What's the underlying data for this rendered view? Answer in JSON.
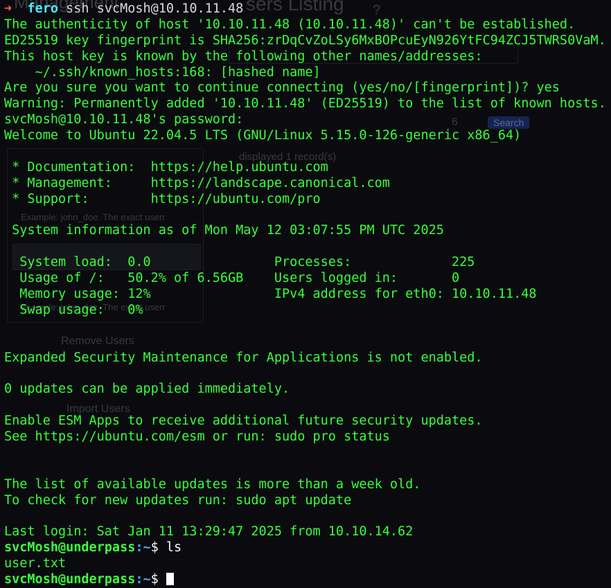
{
  "background": {
    "title_fragment": "sers Listing",
    "partial_texts": [
      "Management",
      "displayed 1 record(s)",
      "Example: john_doe. The exact userr",
      "Example: john_doe. The exact userr",
      "Remove Users",
      "Import Users",
      "6"
    ],
    "badge": "Search"
  },
  "terminal": {
    "prompt_marker": "➜",
    "local_user": "fero",
    "ssh_cmd": "ssh",
    "ssh_target": "svcMosh@10.10.11.48",
    "lines": [
      "The authenticity of host '10.10.11.48 (10.10.11.48)' can't be established.",
      "ED25519 key fingerprint is SHA256:zrDqCvZoLSy6MxBOPcuEyN926YtFC94ZCJ5TWRS0VaM.",
      "This host key is known by the following other names/addresses:",
      "    ~/.ssh/known_hosts:168: [hashed name]",
      "Are you sure you want to continue connecting (yes/no/[fingerprint])? yes",
      "Warning: Permanently added '10.10.11.48' (ED25519) to the list of known hosts.",
      "svcMosh@10.10.11.48's password:",
      "Welcome to Ubuntu 22.04.5 LTS (GNU/Linux 5.15.0-126-generic x86_64)",
      "",
      " * Documentation:  https://help.ubuntu.com",
      " * Management:     https://landscape.canonical.com",
      " * Support:        https://ubuntu.com/pro",
      "",
      " System information as of Mon May 12 03:07:55 PM UTC 2025",
      "",
      "  System load:  0.0                Processes:             225",
      "  Usage of /:   50.2% of 6.56GB    Users logged in:       0",
      "  Memory usage: 12%                IPv4 address for eth0: 10.10.11.48",
      "  Swap usage:   0%",
      "",
      "",
      "Expanded Security Maintenance for Applications is not enabled.",
      "",
      "0 updates can be applied immediately.",
      "",
      "Enable ESM Apps to receive additional future security updates.",
      "See https://ubuntu.com/esm or run: sudo pro status",
      "",
      "",
      "The list of available updates is more than a week old.",
      "To check for new updates run: sudo apt update",
      "",
      "Last login: Sat Jan 11 13:29:47 2025 from 10.10.14.62"
    ],
    "prompt": {
      "user_host": "svcMosh@underpass",
      "path": ":~",
      "symbol": "$ ",
      "command": "ls"
    },
    "ls_output": "user.txt",
    "final_prompt": {
      "user_host": "svcMosh@underpass",
      "path": ":~",
      "symbol": "$ "
    }
  }
}
